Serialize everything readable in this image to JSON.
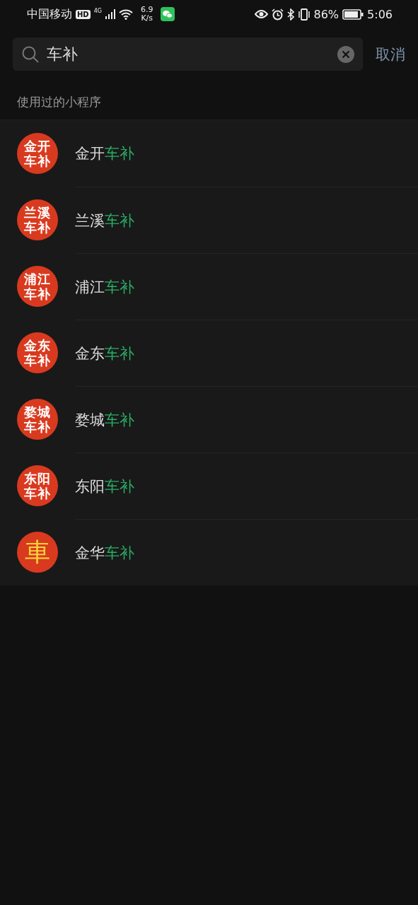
{
  "status_bar": {
    "carrier": "中国移动",
    "hd_badge": "HD",
    "network": "4G",
    "speed_value": "6.9",
    "speed_unit": "K/s",
    "battery": "86%",
    "time": "5:06"
  },
  "search": {
    "value": "车补",
    "cancel": "取消"
  },
  "section_title": "使用过的小程序",
  "items": [
    {
      "kind": "text",
      "logo": [
        "金开",
        "车补"
      ],
      "name": "金开",
      "match": "车补"
    },
    {
      "kind": "text",
      "logo": [
        "兰溪",
        "车补"
      ],
      "name": "兰溪",
      "match": "车补"
    },
    {
      "kind": "text",
      "logo": [
        "浦江",
        "车补"
      ],
      "name": "浦江",
      "match": "车补"
    },
    {
      "kind": "text",
      "logo": [
        "金东",
        "车补"
      ],
      "name": "金东",
      "match": "车补"
    },
    {
      "kind": "text",
      "logo": [
        "婺城",
        "车补"
      ],
      "name": "婺城",
      "match": "车补"
    },
    {
      "kind": "text",
      "logo": [
        "东阳",
        "车补"
      ],
      "name": "东阳",
      "match": "车补"
    },
    {
      "kind": "glyph",
      "logo": [
        "車"
      ],
      "name": "金华",
      "match": "车补"
    }
  ]
}
